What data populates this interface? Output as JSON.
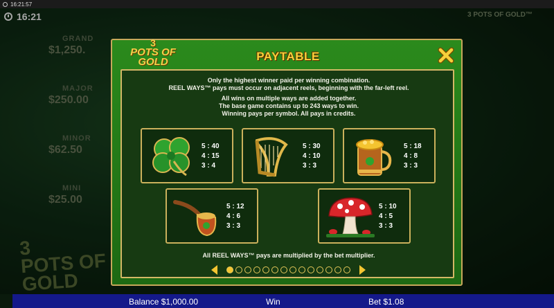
{
  "os_bar": {
    "time": "16:21:57"
  },
  "header": {
    "time": "16:21"
  },
  "background": {
    "title": "3 POTS OF GOLD™",
    "jackpots": [
      {
        "name": "GRAND",
        "amount": "$1,250."
      },
      {
        "name": "MAJOR",
        "amount": "$250.00"
      },
      {
        "name": "MINOR",
        "amount": "$62.50"
      },
      {
        "name": "MINI",
        "amount": "$25.00"
      }
    ],
    "logo_lines": [
      "3",
      "POTS OF",
      "GOLD"
    ]
  },
  "paytable": {
    "title": "PAYTABLE",
    "logo": {
      "number": "3",
      "line1": "POTS OF",
      "line2": "GOLD"
    },
    "rules": [
      "Only the highest winner paid per winning combination.",
      "REEL WAYS™ pays must occur on adjacent reels, beginning with the far-left reel.",
      "All wins on multiple ways are added together.",
      "The base game contains up to 243 ways to win.",
      "Winning pays per symbol. All pays in credits."
    ],
    "symbols": [
      {
        "icon": "clover-icon",
        "pays": [
          "5 : 40",
          "4 : 15",
          "3 : 4"
        ]
      },
      {
        "icon": "harp-icon",
        "pays": [
          "5 : 30",
          "4 : 10",
          "3 : 3"
        ]
      },
      {
        "icon": "ale-tankard-icon",
        "pays": [
          "5 : 18",
          "4 : 8",
          "3 : 3"
        ]
      },
      {
        "icon": "pipe-icon",
        "pays": [
          "5 : 12",
          "4 : 6",
          "3 : 3"
        ]
      },
      {
        "icon": "mushroom-icon",
        "pays": [
          "5 : 10",
          "4 : 5",
          "3 : 3"
        ]
      }
    ],
    "footnote": "All REEL WAYS™ pays are multiplied by the bet multiplier.",
    "page_count": 14,
    "current_page": 1
  },
  "status_bar": {
    "balance": "Balance $1,000.00",
    "win": "Win",
    "bet": "Bet $1.08"
  },
  "colors": {
    "accent_gold": "#f3c531",
    "panel_green": "#2b8a1c",
    "status_blue": "#14198a"
  }
}
